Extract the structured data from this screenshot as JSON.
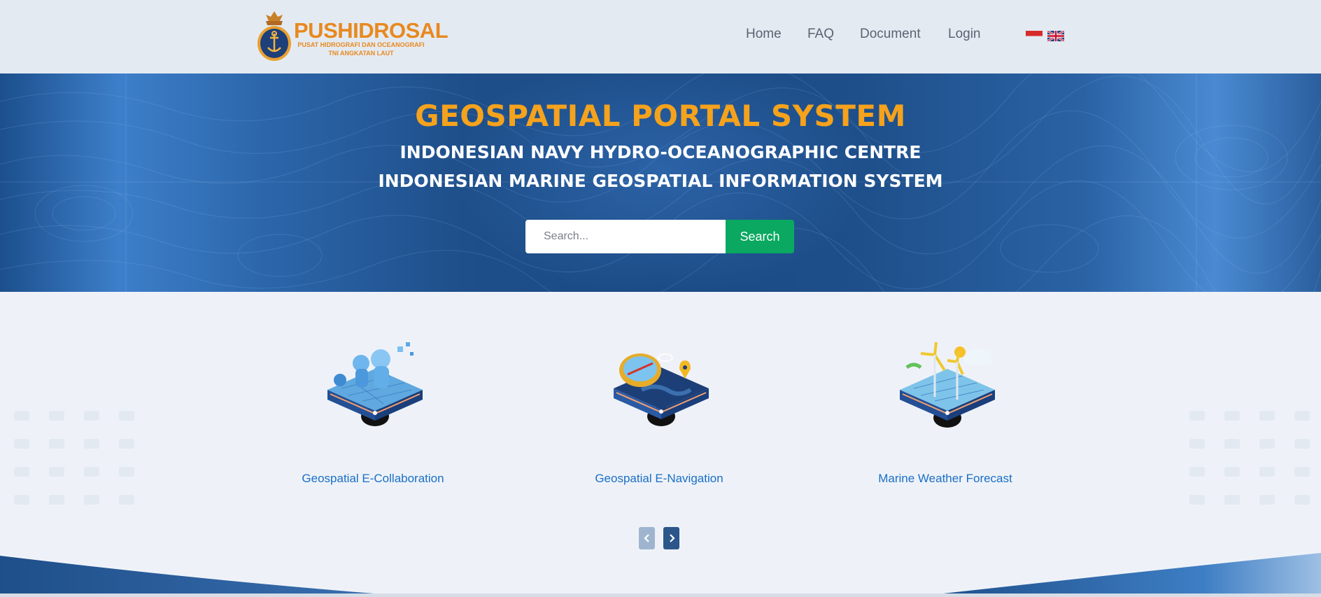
{
  "header": {
    "logo_title": "PUSHIDROSAL",
    "logo_subtitle": "PUSAT HIDROGRAFI DAN OCEANOGRAFI TNI ANGKATAN LAUT",
    "nav": [
      {
        "label": "Home"
      },
      {
        "label": "FAQ"
      },
      {
        "label": "Document"
      },
      {
        "label": "Login"
      }
    ],
    "flags": [
      "indonesia-flag-icon",
      "uk-flag-icon"
    ]
  },
  "hero": {
    "title": "GEOSPATIAL PORTAL SYSTEM",
    "subtitle_1": "INDONESIAN NAVY HYDRO-OCEANOGRAPHIC CENTRE",
    "subtitle_2": "INDONESIAN MARINE GEOSPATIAL INFORMATION SYSTEM",
    "search_placeholder": "Search...",
    "search_button": "Search"
  },
  "services": {
    "cards": [
      {
        "label": "Geospatial E-Collaboration",
        "icon": "e-collaboration-icon"
      },
      {
        "label": "Geospatial E-Navigation",
        "icon": "e-navigation-icon"
      },
      {
        "label": "Marine Weather Forecast",
        "icon": "weather-forecast-icon"
      }
    ],
    "prev_icon": "chevron-left-icon",
    "next_icon": "chevron-right-icon"
  },
  "colors": {
    "accent_orange": "#f5a21c",
    "link_blue": "#1a6fc6",
    "search_green": "#0aa860",
    "hero_blue": "#1e4f8a"
  }
}
